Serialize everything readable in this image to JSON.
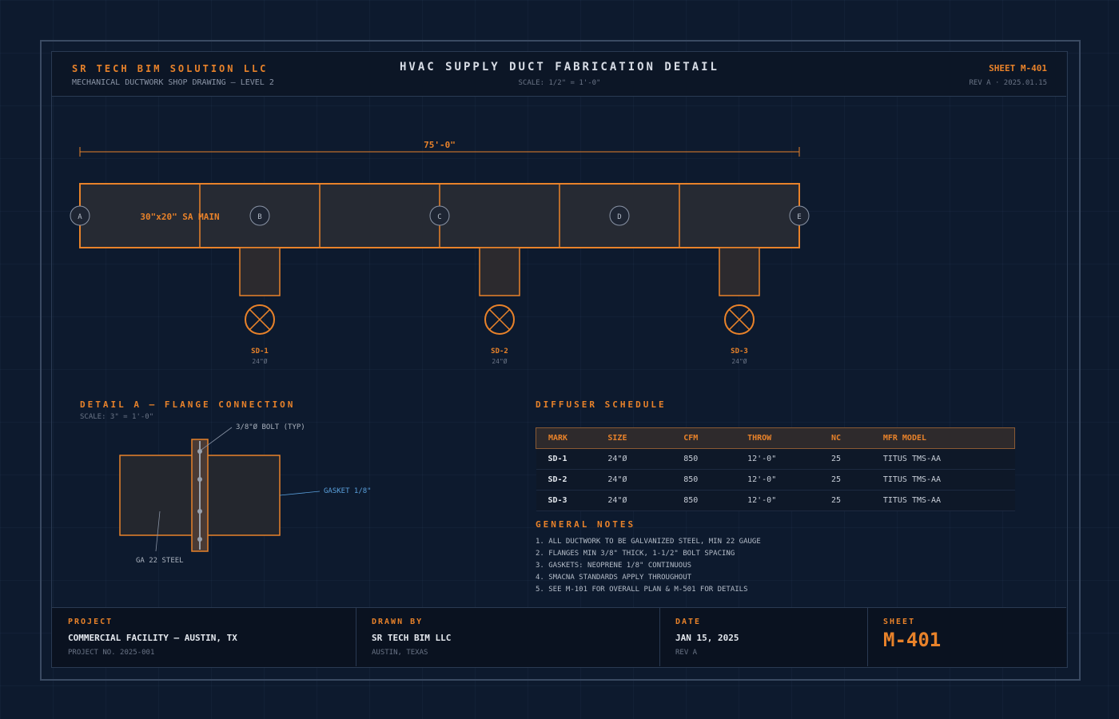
{
  "header": {
    "company": "SR TECH BIM SOLUTION LLC",
    "subtitle": "MECHANICAL DUCTWORK SHOP DRAWING — LEVEL 2",
    "title": "HVAC SUPPLY DUCT FABRICATION DETAIL",
    "scale": "SCALE: 1/2\" = 1'-0\"",
    "sheet": "SHEET M-401",
    "revision": "REV A · 2025.01.15"
  },
  "plan": {
    "overall_dimension": "75'-0\"",
    "main_label": "30\"x20\" SA MAIN",
    "grid_markers": [
      "A",
      "B",
      "C",
      "D",
      "E"
    ],
    "diffusers": [
      {
        "mark": "SD-1",
        "size": "24\"Ø"
      },
      {
        "mark": "SD-2",
        "size": "24\"Ø"
      },
      {
        "mark": "SD-3",
        "size": "24\"Ø"
      }
    ]
  },
  "detail": {
    "title": "DETAIL A — FLANGE CONNECTION",
    "scale": "SCALE: 3\" = 1'-0\"",
    "bolt_label": "3/8\"Ø BOLT (TYP)",
    "gasket_label": "GASKET 1/8\"",
    "steel_label": "GA 22 STEEL"
  },
  "schedule": {
    "title": "DIFFUSER SCHEDULE",
    "columns": [
      "MARK",
      "SIZE",
      "CFM",
      "THROW",
      "NC",
      "MFR MODEL"
    ],
    "rows": [
      [
        "SD-1",
        "24\"Ø",
        "850",
        "12'-0\"",
        "25",
        "TITUS TMS-AA"
      ],
      [
        "SD-2",
        "24\"Ø",
        "850",
        "12'-0\"",
        "25",
        "TITUS TMS-AA"
      ],
      [
        "SD-3",
        "24\"Ø",
        "850",
        "12'-0\"",
        "25",
        "TITUS TMS-AA"
      ]
    ]
  },
  "notes": {
    "title": "GENERAL NOTES",
    "items": [
      "1. ALL DUCTWORK TO BE GALVANIZED STEEL, MIN 22 GAUGE",
      "2. FLANGES MIN 3/8\" THICK, 1-1/2\" BOLT SPACING",
      "3. GASKETS: NEOPRENE 1/8\" CONTINUOUS",
      "4. SMACNA STANDARDS APPLY THROUGHOUT",
      "5. SEE M-101 FOR OVERALL PLAN & M-501 FOR DETAILS"
    ]
  },
  "footer": {
    "project_label": "PROJECT",
    "project_value": "COMMERCIAL FACILITY — AUSTIN, TX",
    "project_no": "PROJECT NO. 2025-001",
    "drawn_label": "DRAWN BY",
    "drawn_value": "SR TECH BIM LLC",
    "drawn_sub": "AUSTIN, TEXAS",
    "date_label": "DATE",
    "date_value": "JAN 15, 2025",
    "date_sub": "REV A",
    "sheet_label": "SHEET",
    "sheet_value": "M-401"
  },
  "colors": {
    "accent": "#e8822a",
    "background": "#0d1a2e",
    "duct_fill": "#262a33",
    "gasket": "#5aa0dc"
  }
}
